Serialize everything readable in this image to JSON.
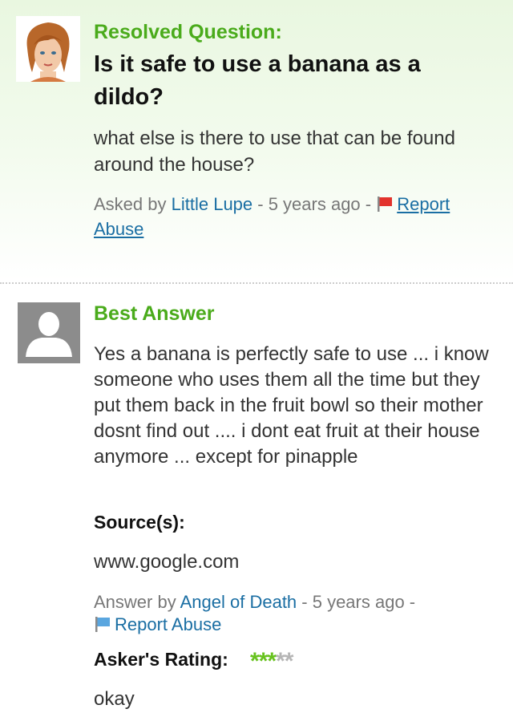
{
  "question": {
    "status_label": "Resolved Question:",
    "title": "Is it safe to use a banana as a dildo?",
    "body": "what else is there to use that can be found around the house?",
    "meta": {
      "asked_by_prefix": "Asked by",
      "author": "Little Lupe",
      "time": " - 5 years ago - ",
      "report_label": "Report Abuse",
      "flag_icon": "red-flag-icon"
    }
  },
  "best_answer": {
    "label": "Best Answer",
    "body": "Yes a banana is perfectly safe to use ... i know someone who uses them all the time but they put them back in the fruit bowl so their mother dosnt find out .... i dont eat fruit at their house anymore ... except for pinapple",
    "source_label": "Source(s):",
    "source_value": "www.google.com",
    "meta": {
      "answer_by_prefix": "Answer by",
      "author": "Angel of Death",
      "time": " - 5 years ago -",
      "report_label": "Report Abuse",
      "flag_icon": "blue-flag-icon"
    },
    "rating_label": "Asker's Rating:",
    "rating": {
      "value": 3,
      "max": 5,
      "on_color": "#67c21e",
      "off_color": "#b5b5b5"
    },
    "comment": "okay"
  },
  "colors": {
    "accent_green": "#4aab1b",
    "link_blue": "#1a6ea3"
  }
}
